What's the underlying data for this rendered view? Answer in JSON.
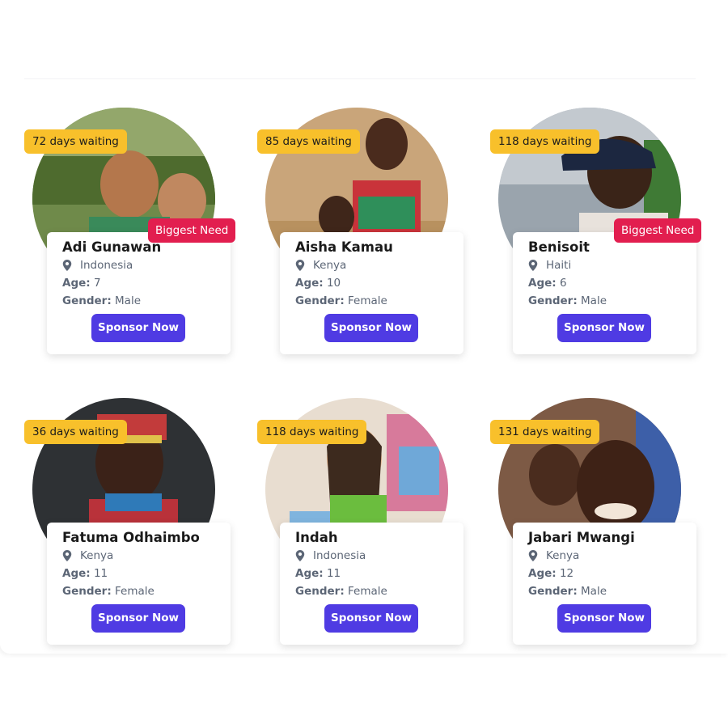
{
  "labels": {
    "age": "Age:",
    "gender": "Gender:",
    "sponsor": "Sponsor Now"
  },
  "children": [
    {
      "waiting": "72 days waiting",
      "badge": "Biggest Need",
      "name": "Adi Gunawan",
      "location": "Indonesia",
      "age": "7",
      "gender": "Male"
    },
    {
      "waiting": "85 days waiting",
      "badge": "",
      "name": "Aisha Kamau",
      "location": "Kenya",
      "age": "10",
      "gender": "Female"
    },
    {
      "waiting": "118 days waiting",
      "badge": "Biggest Need",
      "name": "Benisoit",
      "location": "Haiti",
      "age": "6",
      "gender": "Male"
    },
    {
      "waiting": "36 days waiting",
      "badge": "",
      "name": "Fatuma Odhaimbo",
      "location": "Kenya",
      "age": "11",
      "gender": "Female"
    },
    {
      "waiting": "118 days waiting",
      "badge": "",
      "name": "Indah",
      "location": "Indonesia",
      "age": "11",
      "gender": "Female"
    },
    {
      "waiting": "131 days waiting",
      "badge": "",
      "name": "Jabari Mwangi",
      "location": "Kenya",
      "age": "12",
      "gender": "Male"
    }
  ],
  "colors": {
    "waiting_badge": "#f8c02b",
    "need_badge": "#e21e4f",
    "button": "#4f3be3",
    "muted_text": "#5c6676"
  },
  "icons": {
    "location": "map-pin-icon"
  }
}
